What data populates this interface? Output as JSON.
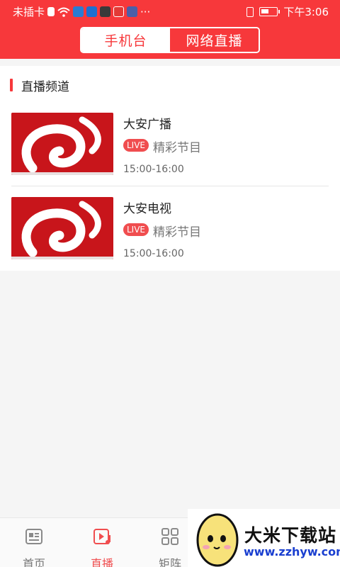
{
  "status_bar": {
    "carrier": "未插卡",
    "more": "···",
    "time": "下午3:06"
  },
  "header": {
    "tabs": [
      {
        "label": "手机台",
        "selected": true
      },
      {
        "label": "网络直播",
        "selected": false
      }
    ]
  },
  "section": {
    "title": "直播频道"
  },
  "channels": [
    {
      "name": "大安广播",
      "badge": "LIVE",
      "program": "精彩节目",
      "time": "15:00-16:00"
    },
    {
      "name": "大安电视",
      "badge": "LIVE",
      "program": "精彩节目",
      "time": "15:00-16:00"
    }
  ],
  "tabbar": {
    "items": [
      {
        "label": "首页",
        "icon": "news-icon",
        "active": false
      },
      {
        "label": "直播",
        "icon": "live-video-icon",
        "active": true
      },
      {
        "label": "矩阵",
        "icon": "grid-icon",
        "active": false
      }
    ]
  },
  "watermark": {
    "text": "大米下载站",
    "url": "www.zzhyw.com"
  },
  "colors": {
    "brand_red": "#f7383b",
    "live_badge": "#f04d4f",
    "background": "#f5f5f5"
  }
}
